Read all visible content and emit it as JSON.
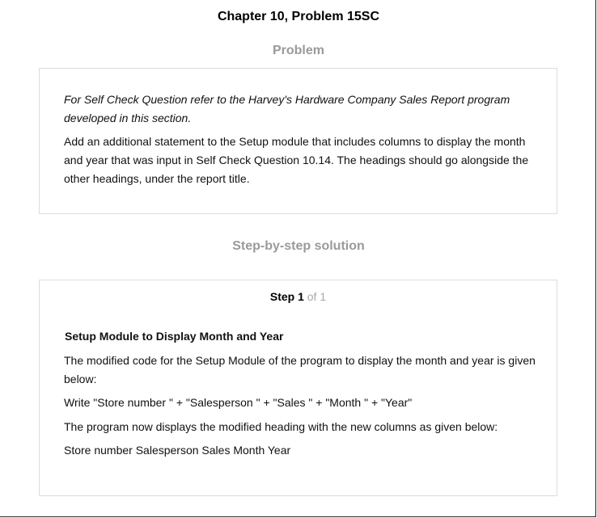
{
  "header": {
    "title": "Chapter 10, Problem 15SC"
  },
  "problem": {
    "heading": "Problem",
    "intro": "For Self Check Question refer to the Harvey's Hardware Company Sales Report program developed in this section.",
    "body": "Add an additional statement to the Setup module that includes columns to display the month and year that was input in Self Check Question 10.14. The headings should go alongside the other headings, under the report title."
  },
  "solution": {
    "heading": "Step-by-step solution",
    "step_word": "Step 1",
    "step_of": "of 1",
    "subheading": "Setup Module to Display Month and Year",
    "para1": "The modified code for the Setup Module of the program to display the month and year is given below:",
    "code": "Write \"Store number \" + \"Salesperson \" + \"Sales \" + \"Month \" + \"Year\"",
    "para2": "The program now displays the modified heading with the new columns as given below:",
    "output": "Store number Salesperson Sales Month Year"
  }
}
